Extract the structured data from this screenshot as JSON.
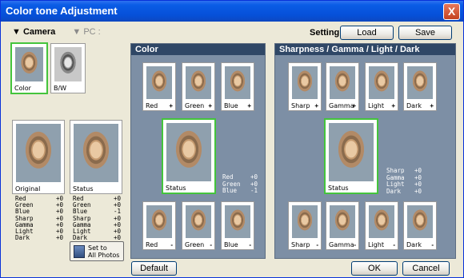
{
  "window": {
    "title": "Color tone Adjustment"
  },
  "tabs": {
    "camera": "▼ Camera",
    "pc": "▼ PC :"
  },
  "source_thumbs": {
    "color": "Color",
    "bw": "B/W"
  },
  "left": {
    "original_label": "Original",
    "status_label": "Status",
    "original_stats": [
      {
        "k": "Red",
        "v": "+0"
      },
      {
        "k": "Green",
        "v": "+0"
      },
      {
        "k": "Blue",
        "v": "+0"
      },
      {
        "k": "Sharp",
        "v": "+0"
      },
      {
        "k": "Gamma",
        "v": "+0"
      },
      {
        "k": "Light",
        "v": "+0"
      },
      {
        "k": "Dark",
        "v": "+0"
      }
    ],
    "status_stats": [
      {
        "k": "Red",
        "v": "+0"
      },
      {
        "k": "Green",
        "v": "+0"
      },
      {
        "k": "Blue",
        "v": "-1"
      },
      {
        "k": "Sharp",
        "v": "+0"
      },
      {
        "k": "Gamma",
        "v": "+0"
      },
      {
        "k": "Light",
        "v": "+0"
      },
      {
        "k": "Dark",
        "v": "+0"
      }
    ],
    "set_all": {
      "line1": "Set to",
      "line2": "All Photos"
    }
  },
  "setting": {
    "label": "Setting",
    "load": "Load",
    "save": "Save"
  },
  "color_panel": {
    "title": "Color",
    "top": [
      {
        "label": "Red",
        "sign": "+"
      },
      {
        "label": "Green",
        "sign": "+"
      },
      {
        "label": "Blue",
        "sign": "+"
      }
    ],
    "bottom": [
      {
        "label": "Red",
        "sign": "-"
      },
      {
        "label": "Green",
        "sign": "-"
      },
      {
        "label": "Blue",
        "sign": "-"
      }
    ],
    "status": "Status",
    "stats": [
      {
        "k": "Red",
        "v": "+0"
      },
      {
        "k": "Green",
        "v": "+0"
      },
      {
        "k": "Blue",
        "v": "-1"
      }
    ]
  },
  "sgld_panel": {
    "title": "Sharpness / Gamma / Light / Dark",
    "top": [
      {
        "label": "Sharp",
        "sign": "+"
      },
      {
        "label": "Gamma",
        "sign": "+"
      },
      {
        "label": "Light",
        "sign": "+"
      },
      {
        "label": "Dark",
        "sign": "+"
      }
    ],
    "bottom": [
      {
        "label": "Sharp",
        "sign": "-"
      },
      {
        "label": "Gamma",
        "sign": "-"
      },
      {
        "label": "Light",
        "sign": "-"
      },
      {
        "label": "Dark",
        "sign": "-"
      }
    ],
    "status": "Status",
    "stats": [
      {
        "k": "Sharp",
        "v": "+0"
      },
      {
        "k": "Gamma",
        "v": "+0"
      },
      {
        "k": "Light",
        "v": "+0"
      },
      {
        "k": "Dark",
        "v": "+0"
      }
    ]
  },
  "buttons": {
    "default": "Default",
    "ok": "OK",
    "cancel": "Cancel",
    "close": "X"
  }
}
